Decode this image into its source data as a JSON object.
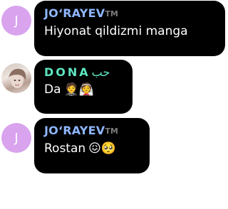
{
  "messages": [
    {
      "avatar_letter": "J",
      "sender": "JO‘RAYEV",
      "badge": "TM",
      "text": "Hiyonat qildizmi manga",
      "emoji": ""
    },
    {
      "avatar_letter": "",
      "sender": "DONA",
      "sender_extra": "حب",
      "text": "Da",
      "emoji": "🤵👰"
    },
    {
      "avatar_letter": "J",
      "sender": "JO‘RAYEV",
      "badge": "TM",
      "text": "Rostan",
      "emoji": "😖🥺"
    }
  ]
}
